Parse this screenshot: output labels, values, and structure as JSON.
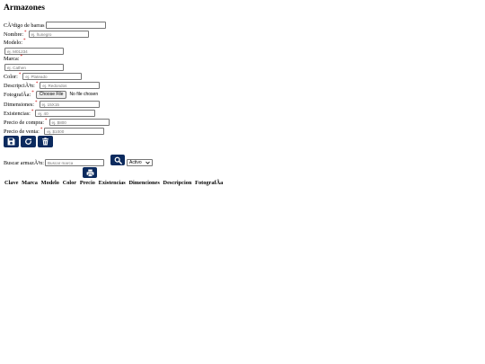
{
  "page": {
    "title": "Armazones"
  },
  "form": {
    "barcode": {
      "label": "CÃ³digo de barras",
      "value": ""
    },
    "name": {
      "label": "Nombre:",
      "required": "*",
      "placeholder": "ej. ñunegro"
    },
    "model": {
      "label": "Modelo:",
      "required": "*",
      "placeholder": "ej. M01234"
    },
    "brand": {
      "label": "Marca:",
      "required": "*",
      "placeholder": "ej. Cathen"
    },
    "color": {
      "label": "Color:",
      "required": "*",
      "placeholder": "ej. Plateado"
    },
    "description": {
      "label": "DescripciÃ³n:",
      "required": "*",
      "placeholder": "ej. Redondos"
    },
    "photo": {
      "label": "FotografÃ­a:",
      "required": "*",
      "button": "Choose File",
      "status": "No file chosen"
    },
    "dimensions": {
      "label": "Dimensiones:",
      "required": "*",
      "placeholder": "ej. 15X15"
    },
    "stock": {
      "label": "Existencias:",
      "required": "*",
      "placeholder": "ej. 40"
    },
    "purchase_price": {
      "label": "Precio de compra:",
      "required": "*",
      "placeholder": "ej. $800"
    },
    "sale_price": {
      "label": "Precio de venta:",
      "required": "*",
      "placeholder": "ej. $1000"
    }
  },
  "actions": {
    "icons": [
      "save-icon",
      "refresh-icon",
      "trash-icon"
    ]
  },
  "search": {
    "label": "Buscar armazÃ³n:",
    "placeholder": "Buscar marca",
    "status_selected": "Activo",
    "search_icon": "search-icon",
    "print_icon": "print-icon"
  },
  "table": {
    "columns": [
      "Clave",
      "Marca",
      "Modelo",
      "Color",
      "Precio",
      "Existencias",
      "Dimenciones",
      "Descripcion",
      "FotografÃ­a"
    ]
  },
  "colors": {
    "button_bg": "#0b2a5e",
    "required": "#cc0000"
  }
}
